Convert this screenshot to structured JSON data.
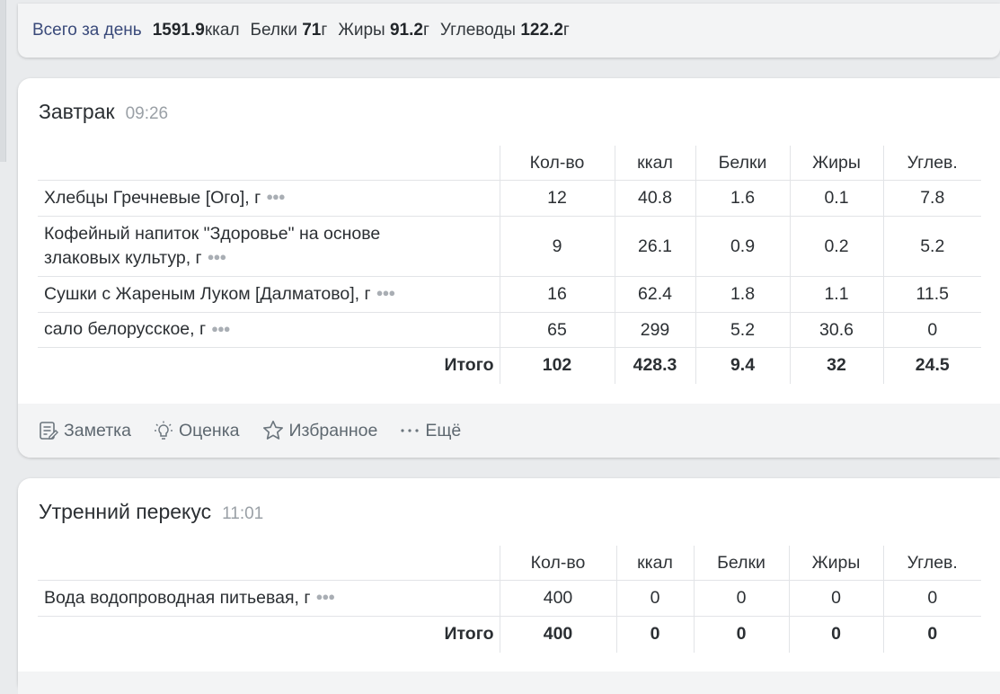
{
  "day_summary": {
    "title": "Всего за день",
    "kcal_value": "1591.9",
    "kcal_unit": "ккал",
    "protein_label": "Белки",
    "protein_value": "71",
    "protein_unit": "г",
    "fat_label": "Жиры",
    "fat_value": "91.2",
    "fat_unit": "г",
    "carbs_label": "Углеводы",
    "carbs_value": "122.2",
    "carbs_unit": "г"
  },
  "columns": {
    "qty": "Кол-во",
    "kcal": "ккал",
    "protein": "Белки",
    "fat": "Жиры",
    "carbs": "Углев."
  },
  "meals": [
    {
      "title": "Завтрак",
      "time": "09:26",
      "items": [
        {
          "name": "Хлебцы Гречневые [Ого], г",
          "qty": "12",
          "kcal": "40.8",
          "protein": "1.6",
          "fat": "0.1",
          "carbs": "7.8"
        },
        {
          "name_line1": "Кофейный напиток \"Здоровье\" на основе",
          "name_line2": "злаковых культур, г",
          "qty": "9",
          "kcal": "26.1",
          "protein": "0.9",
          "fat": "0.2",
          "carbs": "5.2"
        },
        {
          "name": "Сушки с Жареным Луком [Далматово], г",
          "qty": "16",
          "kcal": "62.4",
          "protein": "1.8",
          "fat": "1.1",
          "carbs": "11.5"
        },
        {
          "name": "сало белорусское, г",
          "qty": "65",
          "kcal": "299",
          "protein": "5.2",
          "fat": "30.6",
          "carbs": "0"
        }
      ],
      "total": {
        "label": "Итого",
        "qty": "102",
        "kcal": "428.3",
        "protein": "9.4",
        "fat": "32",
        "carbs": "24.5"
      },
      "actions": {
        "note": "Заметка",
        "rating": "Оценка",
        "favorite": "Избранное",
        "more": "Ещё"
      }
    },
    {
      "title": "Утренний перекус",
      "time": "11:01",
      "items": [
        {
          "name": "Вода водопроводная питьевая, г",
          "qty": "400",
          "kcal": "0",
          "protein": "0",
          "fat": "0",
          "carbs": "0"
        }
      ],
      "total": {
        "label": "Итого",
        "qty": "400",
        "kcal": "0",
        "protein": "0",
        "fat": "0",
        "carbs": "0"
      }
    }
  ],
  "icons": {
    "item_menu": "more-horizontal-icon",
    "note": "note-icon",
    "rating": "lightbulb-icon",
    "favorite": "star-icon",
    "more": "more-horizontal-icon"
  }
}
